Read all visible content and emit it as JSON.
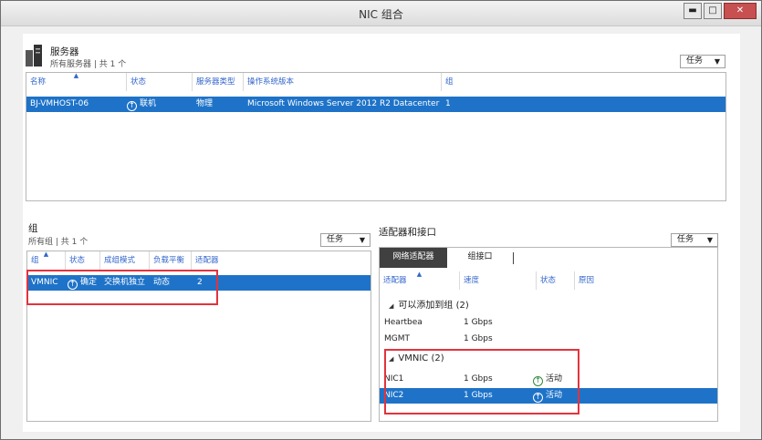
{
  "window": {
    "title": "NIC 组合",
    "min_glyph": "▬",
    "max_glyph": "□",
    "close_glyph": "✕"
  },
  "servers": {
    "title": "服务器",
    "subtitle": "所有服务器 | 共 1 个",
    "tasks_label": "任务",
    "columns": [
      "名称",
      "状态",
      "服务器类型",
      "操作系统版本",
      "组"
    ],
    "rows": [
      {
        "name": "BJ-VMHOST-06",
        "status": "联机",
        "type": "物理",
        "os": "Microsoft Windows Server 2012 R2 Datacenter",
        "group": "1"
      }
    ]
  },
  "teams": {
    "title": "组",
    "subtitle": "所有组 | 共 1 个",
    "tasks_label": "任务",
    "columns": [
      "组",
      "状态",
      "成组模式",
      "负载平衡",
      "适配器"
    ],
    "rows": [
      {
        "team": "VMNIC",
        "status": "确定",
        "mode": "交换机独立",
        "lb": "动态",
        "adapters": "2"
      }
    ]
  },
  "adapters": {
    "title": "适配器和接口",
    "tasks_label": "任务",
    "tabs": [
      "网络适配器",
      "组接口"
    ],
    "columns": [
      "适配器",
      "速度",
      "状态",
      "原因"
    ],
    "groups": [
      {
        "label": "可以添加到组 (2)",
        "rows": [
          {
            "name": "Heartbea",
            "speed": "1 Gbps",
            "status": ""
          },
          {
            "name": "MGMT",
            "speed": "1 Gbps",
            "status": ""
          }
        ]
      },
      {
        "label": "VMNIC (2)",
        "rows": [
          {
            "name": "NIC1",
            "speed": "1 Gbps",
            "status": "活动"
          },
          {
            "name": "NIC2",
            "speed": "1 Gbps",
            "status": "活动"
          }
        ]
      }
    ]
  },
  "icons": {
    "status_up": "↑",
    "dropdown": "▼",
    "expand": "◢",
    "sort": "▲"
  },
  "colors": {
    "selection": "#1e73c8",
    "header_text": "#3366cc",
    "highlight_box": "#e2333d",
    "active_green": "#2d8b3c"
  }
}
